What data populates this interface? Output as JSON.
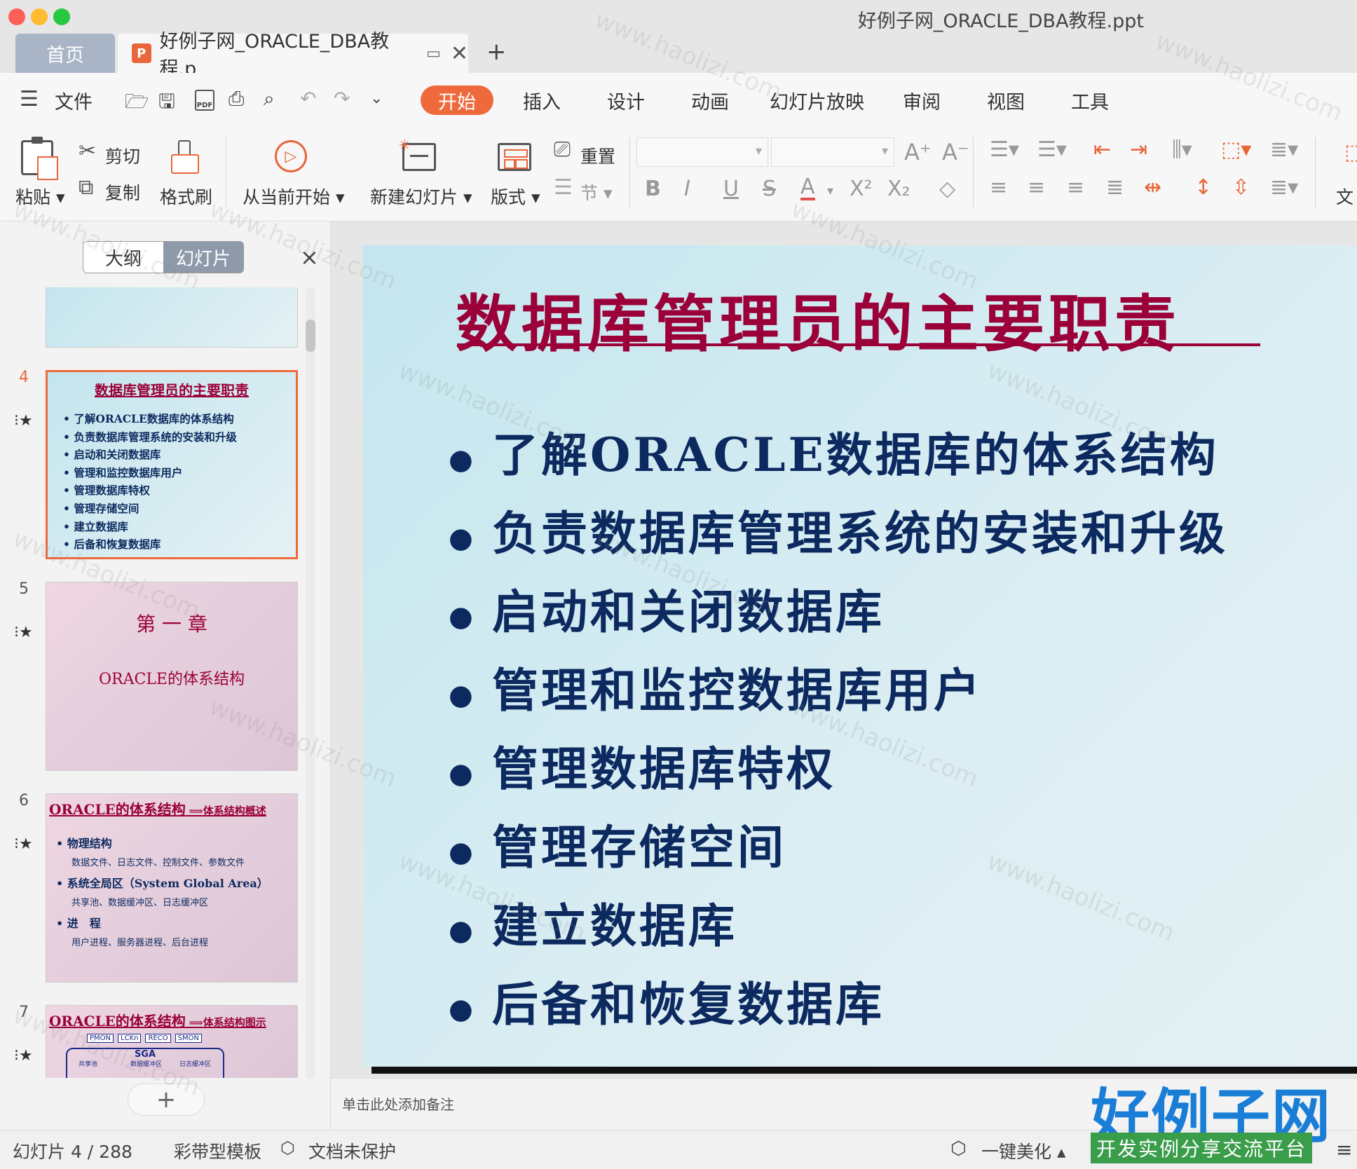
{
  "window": {
    "title": "好例子网_ORACLE_DBA教程.ppt"
  },
  "tabs": {
    "home": "首页",
    "doc": "好例子网_ORACLE_DBA教程.p",
    "add": "+"
  },
  "menu": {
    "file": "文件",
    "items": [
      "开始",
      "插入",
      "设计",
      "动画",
      "幻灯片放映",
      "审阅",
      "视图",
      "工具"
    ]
  },
  "ribbon": {
    "paste": "粘贴",
    "cut": "剪切",
    "copy": "复制",
    "format_painter": "格式刷",
    "from_current": "从当前开始",
    "new_slide": "新建幻灯片",
    "layout": "版式",
    "reset": "重置",
    "section": "节",
    "text_partial": "文"
  },
  "panel": {
    "outline": "大纲",
    "slides": "幻灯片",
    "close": "×"
  },
  "thumbnails": [
    {
      "num": "4",
      "title": "数据库管理员的主要职责",
      "bullets": [
        "了解ORACLE数据库的体系结构",
        "负责数据库管理系统的安装和升级",
        "启动和关闭数据库",
        "管理和监控数据库用户",
        "管理数据库特权",
        "管理存储空间",
        "建立数据库",
        "后备和恢复数据库"
      ]
    },
    {
      "num": "5",
      "title": "第 一 章",
      "subtitle": "ORACLE的体系结构"
    },
    {
      "num": "6",
      "title": "ORACLE的体系结构",
      "arrow_label": "体系结构概述",
      "items": [
        {
          "head": "物理结构",
          "sub": "数据文件、日志文件、控制文件、参数文件"
        },
        {
          "head": "系统全局区（System Global Area）",
          "sub": "共享池、数据缓冲区、日志缓冲区"
        },
        {
          "head": "进　程",
          "sub": "用户进程、服务器进程、后台进程"
        }
      ]
    },
    {
      "num": "7",
      "title": "ORACLE的体系结构",
      "arrow_label": "体系结构图示",
      "procs": [
        "PMON",
        "LCKn",
        "RECO",
        "SMON"
      ],
      "sga": "SGA",
      "sga_parts": [
        "共享池",
        "数据缓冲区",
        "日志缓冲区"
      ]
    }
  ],
  "slide": {
    "title": "数据库管理员的主要职责",
    "bullets": [
      "了解ORACLE数据库的体系结构",
      "负责数据库管理系统的安装和升级",
      "启动和关闭数据库",
      "管理和监控数据库用户",
      "管理数据库特权",
      "管理存储空间",
      "建立数据库",
      "后备和恢复数据库"
    ]
  },
  "notes": {
    "placeholder": "单击此处添加备注"
  },
  "status": {
    "slide_counter": "幻灯片 4 / 288",
    "template": "彩带型模板",
    "protection": "文档未保护",
    "beautify": "一键美化"
  },
  "brand": {
    "name": "好例子网",
    "tagline": "开发实例分享交流平台",
    "watermark": "www.haolizi.com"
  },
  "colors": {
    "accent": "#ee6a3c",
    "slide_title": "#9b0038",
    "slide_text": "#0c2a5f",
    "brand_blue": "#1a7ed6",
    "brand_green": "#3a9d4a"
  }
}
